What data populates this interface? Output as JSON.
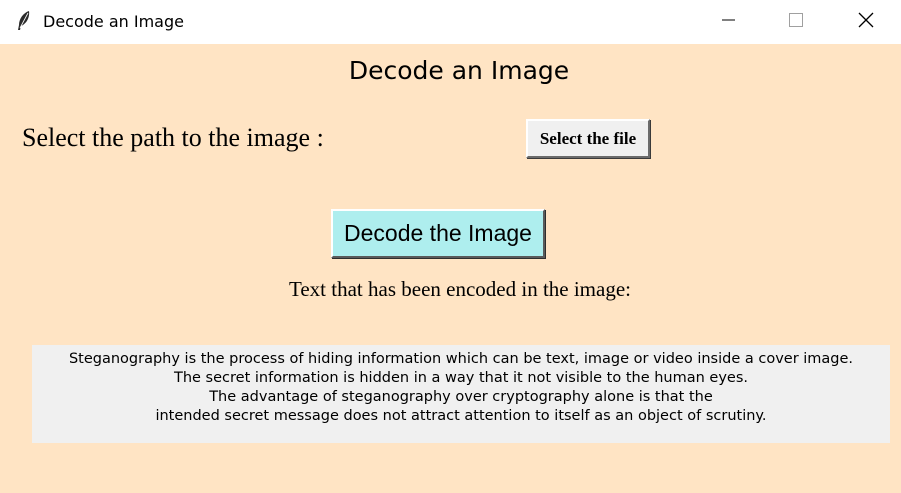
{
  "window": {
    "title": "Decode an Image",
    "background": "#ffe4c4",
    "controls": [
      "minimize-icon",
      "maximize-icon",
      "close-icon"
    ]
  },
  "main": {
    "heading": "Decode an Image",
    "path_label": "Select the path to the image :",
    "select_button_label": "Select the file",
    "decode_button_label": "Decode the Image",
    "decode_button_color": "#aeeeee",
    "encoded_label": "Text that has been encoded in the image:",
    "message_lines": [
      "Steganography is the process of hiding information which can be text, image or video inside a cover image.",
      "The secret information is hidden in a way that it not visible to the human eyes.",
      "The advantage of steganography over cryptography alone is that the",
      "intended secret message does not attract attention to itself as an object of scrutiny."
    ]
  }
}
